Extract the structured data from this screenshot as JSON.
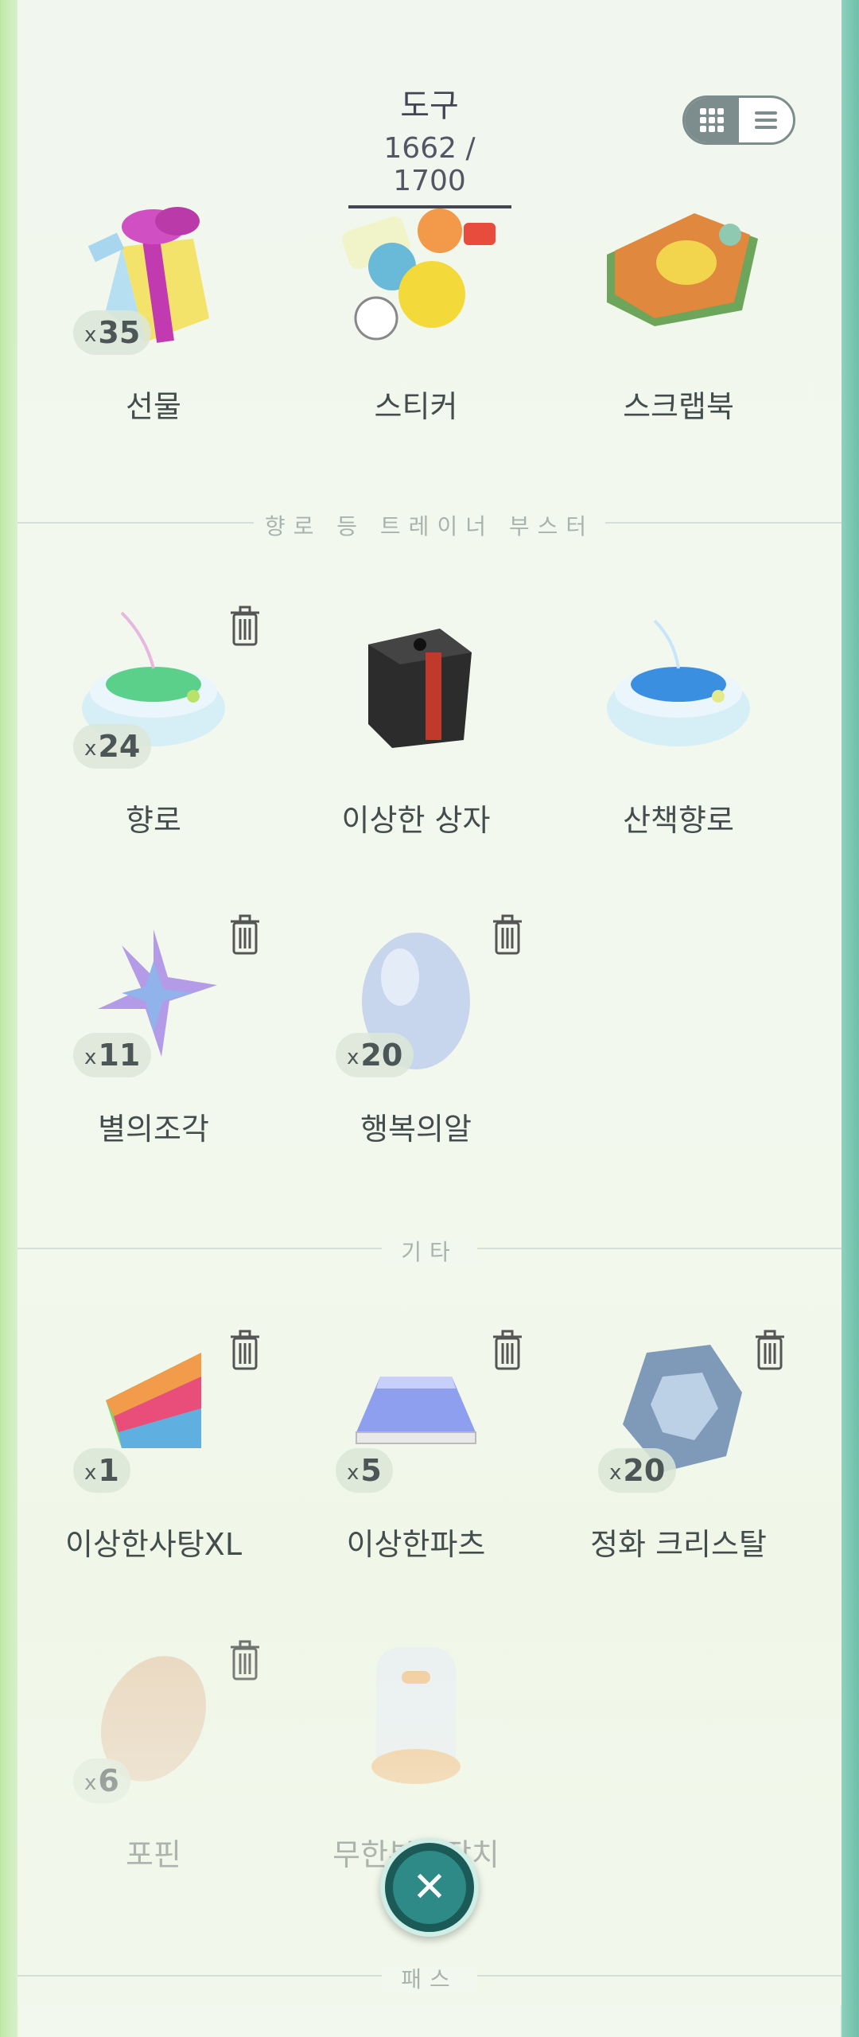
{
  "header": {
    "title": "도구",
    "count": "1662 / 1700"
  },
  "view_toggle": {
    "grid_icon": "grid-icon",
    "list_icon": "list-icon"
  },
  "sections": {
    "boosters": "향로 등 트레이너 부스터",
    "other": "기타",
    "pass": "패스"
  },
  "items": {
    "gift": {
      "name": "선물",
      "qty": "35",
      "x": "x"
    },
    "sticker": {
      "name": "스티커"
    },
    "scrapbook": {
      "name": "스크랩북"
    },
    "incense": {
      "name": "향로",
      "qty": "24",
      "x": "x"
    },
    "mystery_box": {
      "name": "이상한 상자"
    },
    "daily_incense": {
      "name": "산책향로"
    },
    "star_piece": {
      "name": "별의조각",
      "qty": "11",
      "x": "x"
    },
    "lucky_egg": {
      "name": "행복의알",
      "qty": "20",
      "x": "x"
    },
    "rare_candy_xl": {
      "name": "이상한사탕XL",
      "qty": "1",
      "x": "x"
    },
    "rare_parts": {
      "name": "이상한파츠",
      "qty": "5",
      "x": "x"
    },
    "purify_crystal": {
      "name": "정화 크리스탈",
      "qty": "20",
      "x": "x"
    },
    "pokepin": {
      "name": "포핀",
      "qty": "6",
      "x": "x"
    },
    "infinite_incubator": {
      "name": "무한부화장치"
    }
  },
  "colors": {
    "accent": "#2d8a86",
    "text": "#444d4d",
    "badge_bg": "#dce6d7"
  }
}
